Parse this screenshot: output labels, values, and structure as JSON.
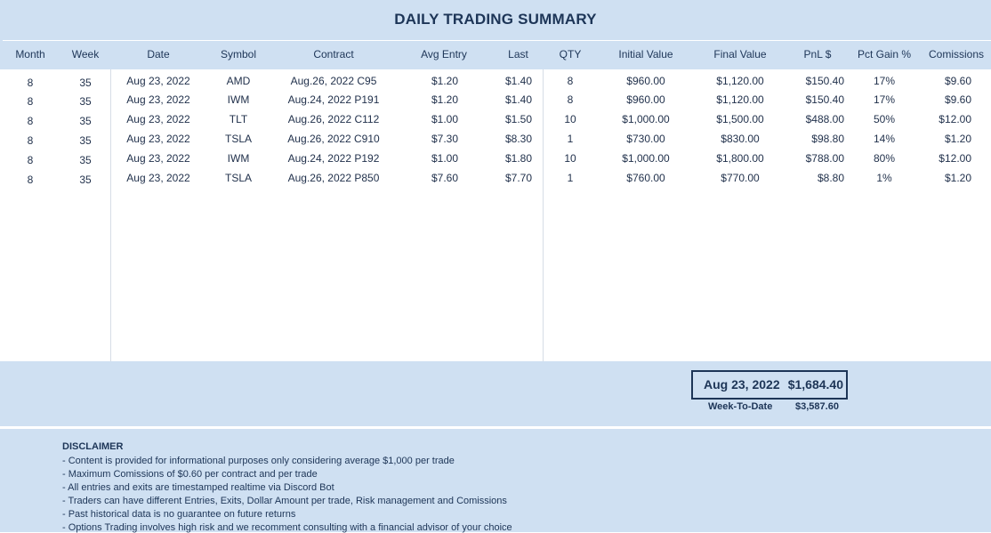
{
  "title": "DAILY TRADING SUMMARY",
  "columns": {
    "month": "Month",
    "week": "Week",
    "date": "Date",
    "symbol": "Symbol",
    "contract": "Contract",
    "avg_entry": "Avg Entry",
    "last": "Last",
    "qty": "QTY",
    "initial_value": "Initial Value",
    "final_value": "Final Value",
    "pnl": "PnL $",
    "pct_gain": "Pct Gain %",
    "comissions": "Comissions"
  },
  "rows": [
    {
      "month": "8",
      "week": "35",
      "date": "Aug 23, 2022",
      "symbol": "AMD",
      "contract": "Aug.26, 2022 C95",
      "avg_entry": "$1.20",
      "last": "$1.40",
      "qty": "8",
      "initial_value": "$960.00",
      "final_value": "$1,120.00",
      "pnl": "$150.40",
      "pct_gain": "17%",
      "comissions": "$9.60"
    },
    {
      "month": "8",
      "week": "35",
      "date": "Aug 23, 2022",
      "symbol": "IWM",
      "contract": "Aug.24, 2022 P191",
      "avg_entry": "$1.20",
      "last": "$1.40",
      "qty": "8",
      "initial_value": "$960.00",
      "final_value": "$1,120.00",
      "pnl": "$150.40",
      "pct_gain": "17%",
      "comissions": "$9.60"
    },
    {
      "month": "8",
      "week": "35",
      "date": "Aug 23, 2022",
      "symbol": "TLT",
      "contract": "Aug.26, 2022 C112",
      "avg_entry": "$1.00",
      "last": "$1.50",
      "qty": "10",
      "initial_value": "$1,000.00",
      "final_value": "$1,500.00",
      "pnl": "$488.00",
      "pct_gain": "50%",
      "comissions": "$12.00"
    },
    {
      "month": "8",
      "week": "35",
      "date": "Aug 23, 2022",
      "symbol": "TSLA",
      "contract": "Aug.26, 2022 C910",
      "avg_entry": "$7.30",
      "last": "$8.30",
      "qty": "1",
      "initial_value": "$730.00",
      "final_value": "$830.00",
      "pnl": "$98.80",
      "pct_gain": "14%",
      "comissions": "$1.20"
    },
    {
      "month": "8",
      "week": "35",
      "date": "Aug 23, 2022",
      "symbol": "IWM",
      "contract": "Aug.24, 2022 P192",
      "avg_entry": "$1.00",
      "last": "$1.80",
      "qty": "10",
      "initial_value": "$1,000.00",
      "final_value": "$1,800.00",
      "pnl": "$788.00",
      "pct_gain": "80%",
      "comissions": "$12.00"
    },
    {
      "month": "8",
      "week": "35",
      "date": "Aug 23, 2022",
      "symbol": "TSLA",
      "contract": "Aug.26, 2022 P850",
      "avg_entry": "$7.60",
      "last": "$7.70",
      "qty": "1",
      "initial_value": "$760.00",
      "final_value": "$770.00",
      "pnl": "$8.80",
      "pct_gain": "1%",
      "comissions": "$1.20"
    }
  ],
  "summary": {
    "date": "Aug 23, 2022",
    "total": "$1,684.40",
    "week_to_date_label": "Week-To-Date",
    "week_to_date_value": "$3,587.60"
  },
  "disclaimer": {
    "title": "DISCLAIMER",
    "lines": [
      "- Content is provided for informational purposes only considering average $1,000 per trade",
      "- Maximum Comissions of $0.60 per contract and per trade",
      "- All entries and exits are timestamped realtime via Discord Bot",
      "- Traders can have different Entries, Exits, Dollar Amount per trade, Risk management and Comissions",
      "- Past historical data is no guarantee on future returns",
      "- Options Trading involves high risk and we recomment consulting with a financial advisor of your choice"
    ]
  }
}
